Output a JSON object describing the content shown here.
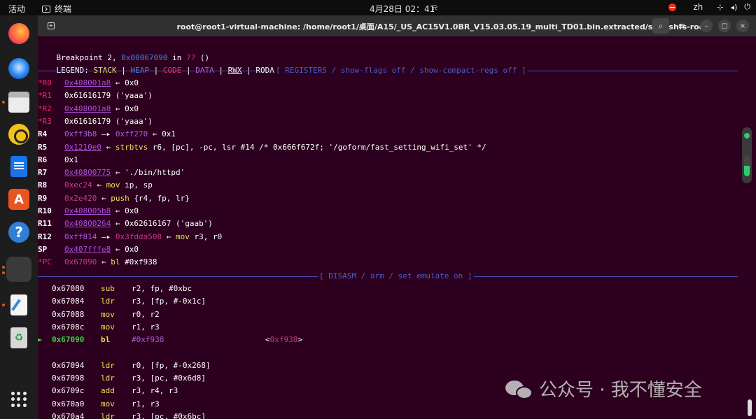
{
  "topbar": {
    "activities": "活动",
    "app_name": "终端",
    "clock": "4月28日 02：41",
    "lang": "zh",
    "bell_icon": "bell-icon",
    "network_icon": "network-icon",
    "volume_icon": "volume-icon",
    "power_icon": "power-icon"
  },
  "dock": {
    "items": [
      {
        "icon": "firefox-icon"
      },
      {
        "icon": "thunderbird-icon"
      },
      {
        "icon": "files-icon"
      },
      {
        "icon": "rhythmbox-icon"
      },
      {
        "icon": "writer-icon"
      },
      {
        "icon": "app-store-icon",
        "glyph": "A"
      },
      {
        "icon": "help-icon",
        "glyph": "?"
      },
      {
        "icon": "terminal-icon",
        "glyph": ">_"
      },
      {
        "icon": "text-editor-icon"
      },
      {
        "icon": "trash-icon",
        "glyph": "♻"
      }
    ],
    "apps_grid_icon": "show-apps-icon"
  },
  "window": {
    "title": "root@root1-virtual-machine: /home/root1/桌面/A15/_US_AC15V1.0BR_V15.03.05.19_multi_TD01.bin.extracted/squashfs-root",
    "new_tab_icon": "new-tab-icon",
    "search_icon": "search-icon",
    "menu_icon": "hamburger-menu-icon",
    "min_glyph": "–",
    "max_glyph": "▢",
    "close_glyph": "×"
  },
  "terminal": {
    "breakpoint": {
      "prefix": "Breakpoint 2, ",
      "addr": "0x00067090",
      "in": " in ",
      "func": "??",
      "suffix": " ()"
    },
    "legend": {
      "label": "LEGEND: ",
      "stack": "STACK",
      "heap": "HEAP",
      "code": "CODE",
      "data": "DATA",
      "rwx": "RWX",
      "rodata": "RODATA",
      "sep": " | "
    },
    "registers_header": "[ REGISTERS / show-flags off / show-compact-regs off ]",
    "registers": [
      {
        "name": "*R0",
        "mod": true,
        "parts": [
          {
            "t": "0x408001a8",
            "c": "c-link"
          },
          {
            "t": " ← 0x0",
            "c": "c-white"
          }
        ]
      },
      {
        "name": "*R1",
        "mod": true,
        "parts": [
          {
            "t": "0x61616179 ('yaaa')",
            "c": "c-white"
          }
        ]
      },
      {
        "name": "*R2",
        "mod": true,
        "parts": [
          {
            "t": "0x408001a8",
            "c": "c-link"
          },
          {
            "t": " ← 0x0",
            "c": "c-white"
          }
        ]
      },
      {
        "name": "*R3",
        "mod": true,
        "parts": [
          {
            "t": "0x61616179 ('yaaa')",
            "c": "c-white"
          }
        ]
      },
      {
        "name": "R4",
        "mod": false,
        "parts": [
          {
            "t": "0xff3b8",
            "c": "c-purple"
          },
          {
            "t": " —▸ ",
            "c": "c-white"
          },
          {
            "t": "0xff270",
            "c": "c-purple"
          },
          {
            "t": " ← 0x1",
            "c": "c-white"
          }
        ]
      },
      {
        "name": "R5",
        "mod": false,
        "parts": [
          {
            "t": "0x1210e0",
            "c": "c-link"
          },
          {
            "t": " ← ",
            "c": "c-white"
          },
          {
            "t": "strbtvs",
            "c": "c-yellow"
          },
          {
            "t": " r6, [pc], -pc, lsr #14 /* 0x666f672f; '/goform/fast_setting_wifi_set' */",
            "c": "c-white"
          }
        ]
      },
      {
        "name": "R6",
        "mod": false,
        "parts": [
          {
            "t": "0x1",
            "c": "c-white"
          }
        ]
      },
      {
        "name": "R7",
        "mod": false,
        "parts": [
          {
            "t": "0x40800775",
            "c": "c-link"
          },
          {
            "t": " ← './bin/httpd'",
            "c": "c-white"
          }
        ]
      },
      {
        "name": "R8",
        "mod": false,
        "parts": [
          {
            "t": "0xec24",
            "c": "c-code"
          },
          {
            "t": " ← ",
            "c": "c-white"
          },
          {
            "t": "mov",
            "c": "c-yellow"
          },
          {
            "t": " ip, sp",
            "c": "c-white"
          }
        ]
      },
      {
        "name": "R9",
        "mod": false,
        "parts": [
          {
            "t": "0x2e420",
            "c": "c-code"
          },
          {
            "t": " ← ",
            "c": "c-white"
          },
          {
            "t": "push",
            "c": "c-yellow"
          },
          {
            "t": " {r4, fp, lr}",
            "c": "c-white"
          }
        ]
      },
      {
        "name": "R10",
        "mod": false,
        "parts": [
          {
            "t": "0x408005b8",
            "c": "c-link"
          },
          {
            "t": " ← 0x0",
            "c": "c-white"
          }
        ]
      },
      {
        "name": "R11",
        "mod": false,
        "parts": [
          {
            "t": "0x40800264",
            "c": "c-link"
          },
          {
            "t": " ← 0x62616167 ('gaab')",
            "c": "c-white"
          }
        ]
      },
      {
        "name": "R12",
        "mod": false,
        "parts": [
          {
            "t": "0xff814",
            "c": "c-purple"
          },
          {
            "t": " —▸ ",
            "c": "c-white"
          },
          {
            "t": "0x3fdda508",
            "c": "c-code"
          },
          {
            "t": " ← ",
            "c": "c-white"
          },
          {
            "t": "mov",
            "c": "c-yellow"
          },
          {
            "t": " r3, r0",
            "c": "c-white"
          }
        ]
      },
      {
        "name": "SP",
        "mod": false,
        "parts": [
          {
            "t": "0x407fffe8",
            "c": "c-link"
          },
          {
            "t": " ← 0x0",
            "c": "c-white"
          }
        ]
      },
      {
        "name": "*PC",
        "mod": true,
        "parts": [
          {
            "t": "0x67090",
            "c": "c-code"
          },
          {
            "t": " ← ",
            "c": "c-white"
          },
          {
            "t": "bl",
            "c": "c-yellow"
          },
          {
            "t": " #0xf938",
            "c": "c-white"
          }
        ]
      }
    ],
    "disasm_header": "[ DISASM / arm / set emulate on ]",
    "disasm": [
      {
        "addr": "0x67080",
        "op": "sub",
        "args": "r2, fp, #0xbc",
        "current": false
      },
      {
        "addr": "0x67084",
        "op": "ldr",
        "args": "r3, [fp, #-0x1c]",
        "current": false
      },
      {
        "addr": "0x67088",
        "op": "mov",
        "args": "r0, r2",
        "current": false
      },
      {
        "addr": "0x6708c",
        "op": "mov",
        "args": "r1, r3",
        "current": false
      },
      {
        "addr": "0x67090",
        "op": "bl",
        "args": "#0xf938",
        "current": true,
        "target": "<0xf938>",
        "marker": "►"
      },
      {
        "addr": "0x67094",
        "op": "ldr",
        "args": "r0, [fp, #-0x268]",
        "current": false
      },
      {
        "addr": "0x67098",
        "op": "ldr",
        "args": "r3, [pc, #0x6d8]",
        "current": false
      },
      {
        "addr": "0x6709c",
        "op": "add",
        "args": "r3, r4, r3",
        "current": false
      },
      {
        "addr": "0x670a0",
        "op": "mov",
        "args": "r1, r3",
        "current": false
      },
      {
        "addr": "0x670a4",
        "op": "ldr",
        "args": "r3, [pc, #0x6bc]",
        "current": false
      }
    ]
  },
  "watermark": {
    "text": "公众号 · 我不懂安全",
    "icon": "wechat-logo-icon"
  }
}
